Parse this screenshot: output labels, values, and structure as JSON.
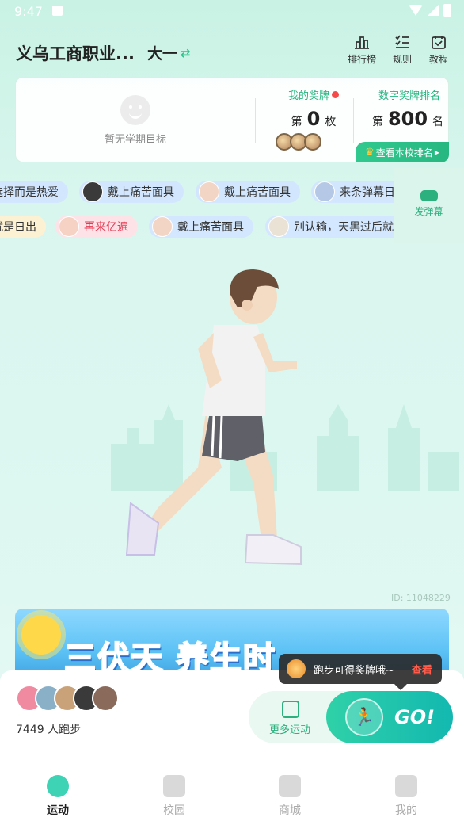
{
  "status_bar": {
    "time": "9:47"
  },
  "header": {
    "school": "义乌工商职业...",
    "grade": "大一",
    "grade_switch_icon": "swap-arrows-icon",
    "buttons": [
      {
        "label": "排行榜",
        "icon": "bar-chart-icon"
      },
      {
        "label": "规则",
        "icon": "list-icon"
      },
      {
        "label": "教程",
        "icon": "calendar-check-icon"
      }
    ]
  },
  "medal_card": {
    "goal_text": "暂无学期目标",
    "my_medal_title": "我的奖牌",
    "medal_prefix": "第",
    "medal_count": "0",
    "medal_unit": "枚",
    "rank_title": "数字奖牌排名",
    "rank_prefix": "第",
    "rank_value": "800",
    "rank_unit": "名",
    "rank_button": "查看本校排名"
  },
  "danmu": {
    "row1": [
      {
        "text": "选择而是热爱",
        "avatar": false,
        "style": "blue"
      },
      {
        "text": "戴上痛苦面具",
        "avatar": true,
        "style": "blue"
      },
      {
        "text": "戴上痛苦面具",
        "avatar": true,
        "style": "blue"
      },
      {
        "text": "来条弹幕日",
        "avatar": true,
        "style": "blue"
      }
    ],
    "row2": [
      {
        "text": "就是日出",
        "avatar": false,
        "style": "yellow"
      },
      {
        "text": "再来亿遍",
        "avatar": true,
        "style": "pink"
      },
      {
        "text": "戴上痛苦面具",
        "avatar": true,
        "style": "blue"
      },
      {
        "text": "别认输，天黑过后就",
        "avatar": true,
        "style": "blue"
      }
    ],
    "send_label": "发弹幕"
  },
  "id_text": "ID: 11048229",
  "banner": {
    "title": "三伏天 养生时"
  },
  "tooltip": {
    "text": "跑步可得奖牌哦~",
    "action": "查看"
  },
  "runners": {
    "count": "7449",
    "unit": "人跑步"
  },
  "more_sport": "更多运动",
  "go_label": "GO!",
  "tabs": [
    {
      "label": "运动",
      "icon": "sport-icon",
      "active": true
    },
    {
      "label": "校园",
      "icon": "campus-icon",
      "active": false
    },
    {
      "label": "商城",
      "icon": "shop-bag-icon",
      "active": false
    },
    {
      "label": "我的",
      "icon": "profile-icon",
      "active": false
    }
  ]
}
